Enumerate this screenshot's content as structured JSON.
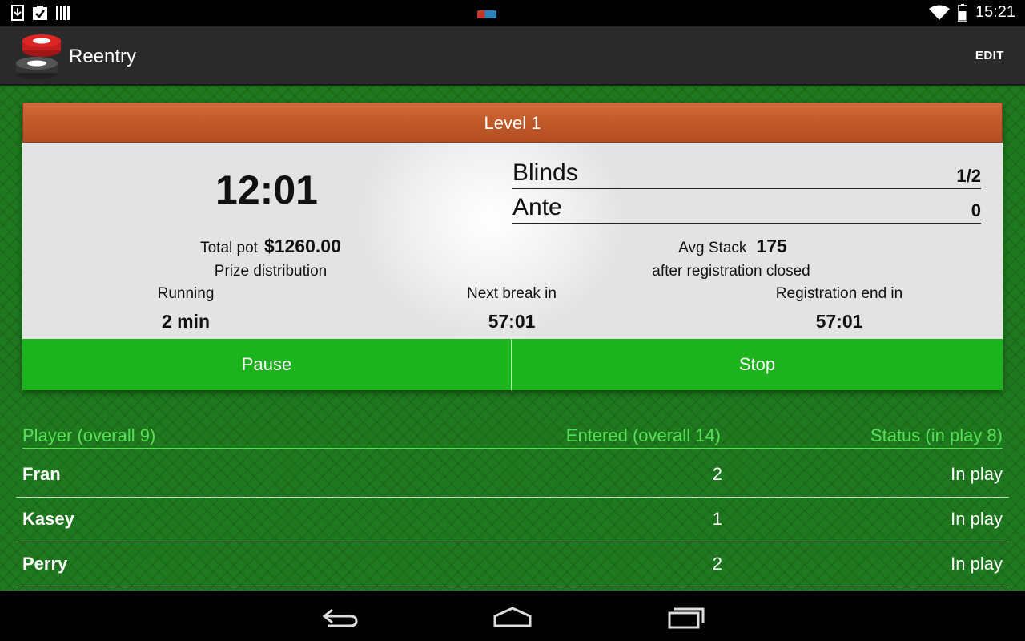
{
  "status_bar": {
    "time": "15:21",
    "left_icons": [
      "download-icon",
      "clipboard-check-icon",
      "barcode-icon"
    ],
    "right_icons": [
      "wifi-icon",
      "battery-icon"
    ]
  },
  "action_bar": {
    "title": "Reentry",
    "edit_label": "EDIT",
    "app_icon": "poker-chips-icon"
  },
  "level": {
    "title": "Level 1"
  },
  "clock": "12:01",
  "blinds": {
    "blinds_label": "Blinds",
    "blinds_value": "1/2",
    "ante_label": "Ante",
    "ante_value": "0"
  },
  "pot": {
    "label": "Total pot",
    "value": "$1260.00",
    "prize_link": "Prize distribution"
  },
  "avg_stack": {
    "label": "Avg Stack",
    "value": "175",
    "note": "after registration closed"
  },
  "stats": {
    "running_label": "Running",
    "running_value": "2 min",
    "break_label": "Next break in",
    "break_value": "57:01",
    "reg_label": "Registration end in",
    "reg_value": "57:01"
  },
  "buttons": {
    "pause": "Pause",
    "stop": "Stop"
  },
  "table": {
    "headers": {
      "player": "Player (overall 9)",
      "entered": "Entered (overall 14)",
      "status": "Status (in play 8)"
    },
    "rows": [
      {
        "name": "Fran",
        "entered": "2",
        "status": "In play"
      },
      {
        "name": "Kasey",
        "entered": "1",
        "status": "In play"
      },
      {
        "name": "Perry",
        "entered": "2",
        "status": "In play"
      }
    ]
  },
  "colors": {
    "felt": "#1f7a1f",
    "button_green": "#1db31d",
    "header_green": "#55e055",
    "level_bar": "#c25a2a"
  }
}
